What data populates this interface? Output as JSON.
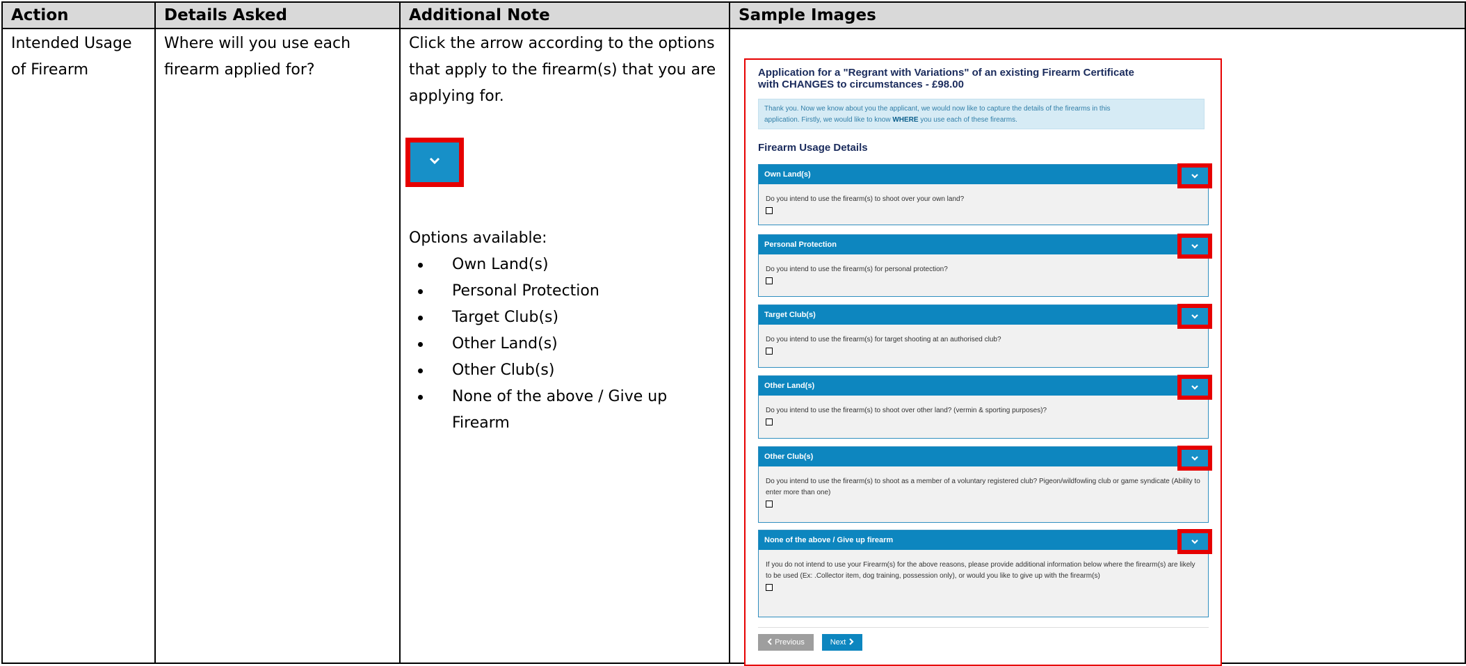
{
  "table": {
    "headers": [
      "Action",
      "Details Asked",
      "Additional Note",
      "Sample Images"
    ],
    "action_lines": [
      "Intended Usage",
      "of Firearm"
    ],
    "details_lines": [
      "Where will you use each",
      "firearm applied for?"
    ],
    "note_lines": [
      "Click the arrow according to the options",
      "that apply to the firearm(s) that you are",
      "applying for."
    ],
    "options_title": "Options available:",
    "options": [
      "Own Land(s)",
      "Personal Protection",
      "Target Club(s)",
      "Other Land(s)",
      "Other Club(s)"
    ],
    "options_last_lines": [
      "None of the above / Give up",
      "Firearm"
    ]
  },
  "sample": {
    "title_lines": [
      "Application for a \"Regrant with Variations\" of an existing Firearm Certificate",
      "with CHANGES to circumstances - £98.00"
    ],
    "info_line1": "Thank you. Now we know about you the applicant, we would now like to capture the details of the firearms in this",
    "info_line2_before": "application. Firstly, we would like to know ",
    "info_line2_bold": "WHERE",
    "info_line2_after": " you use each of these firearms.",
    "section_heading": "Firearm Usage Details",
    "panels": [
      {
        "title": "Own Land(s)",
        "question": "Do you intend to use the firearm(s) to shoot over your own land?"
      },
      {
        "title": "Personal Protection",
        "question": "Do you intend to use the firearm(s) for personal protection?"
      },
      {
        "title": "Target Club(s)",
        "question": "Do you intend to use the firearm(s) for target shooting at an authorised club?"
      },
      {
        "title": "Other Land(s)",
        "question": "Do you intend to use the firearm(s) to shoot over other land? (vermin & sporting purposes)?"
      },
      {
        "title": "Other Club(s)",
        "question": "Do you intend to use the firearm(s) to shoot as a member of a voluntary registered club? Pigeon/wildfowling club or game syndicate (Ability to enter more than one)"
      },
      {
        "title": "None of the above / Give up firearm",
        "question": "If you do not intend to use your Firearm(s) for the above reasons, please provide additional information below where the firearm(s) are likely to be used (Ex: .Collector item, dog training, possession only), or would you like to give up with the firearm(s)"
      }
    ],
    "prev_label": "Previous",
    "next_label": "Next"
  },
  "colors": {
    "header_bg": "#d9d9d9",
    "highlight_red": "#e60000",
    "panel_blue": "#0d86bf"
  },
  "icons": [
    "chevron-down-icon",
    "chevron-left-icon",
    "chevron-right-icon"
  ]
}
